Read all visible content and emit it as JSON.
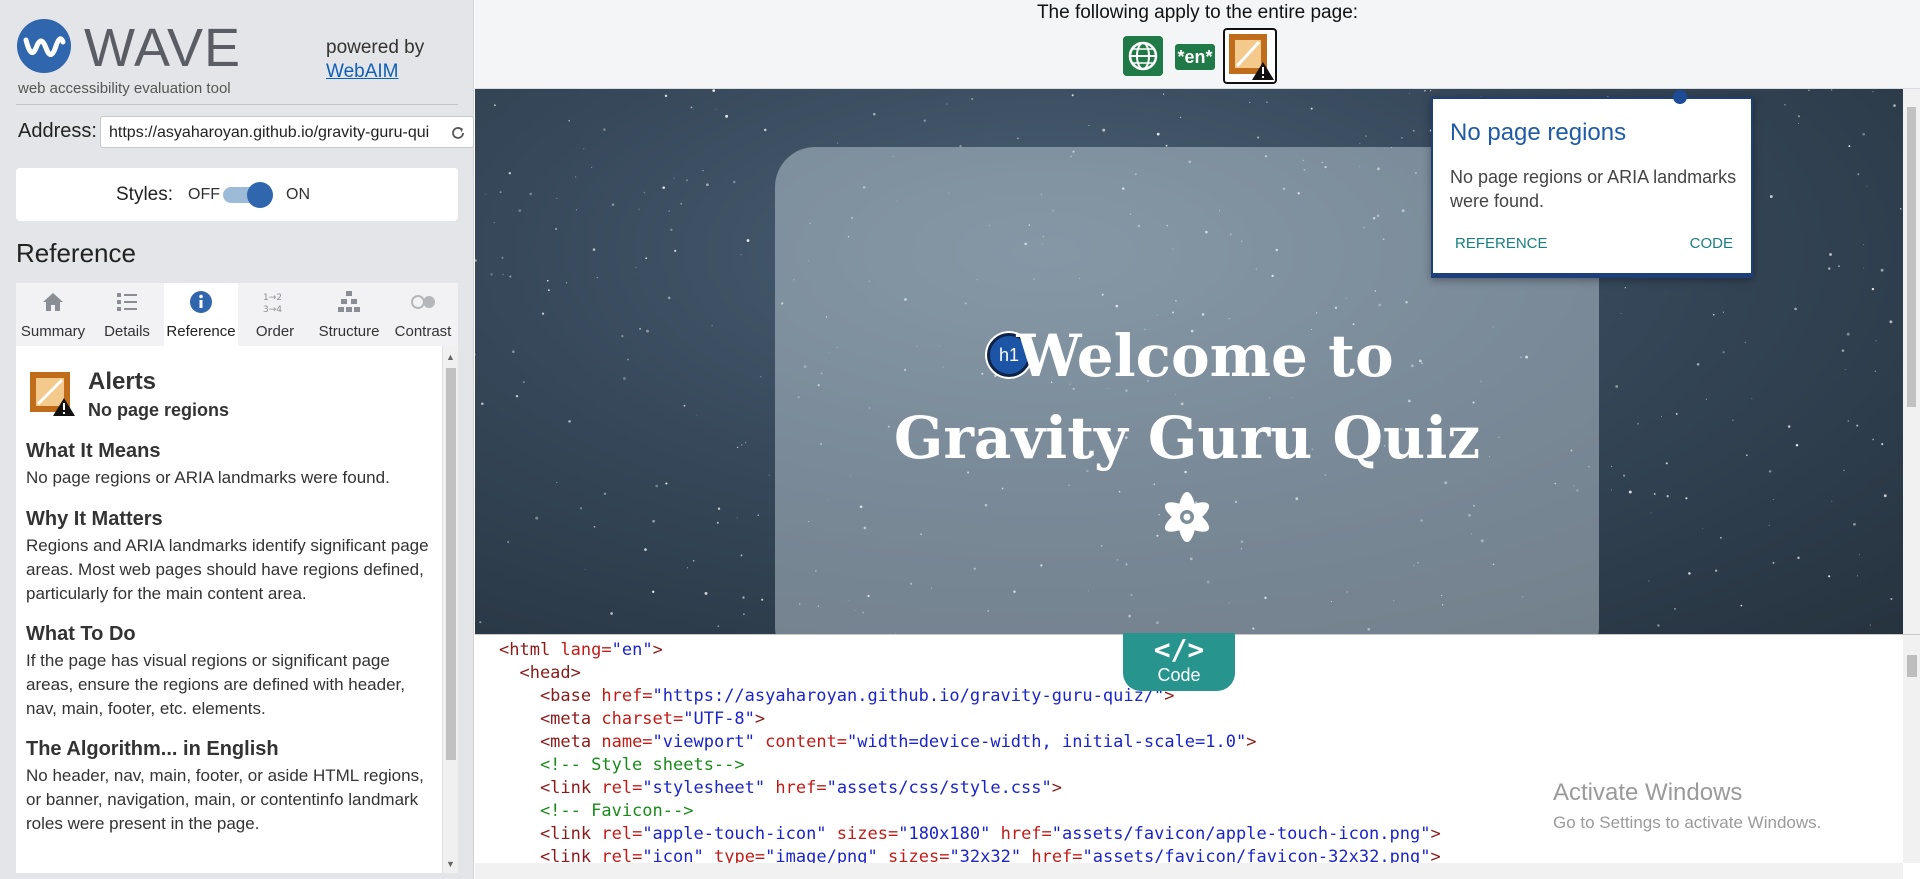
{
  "colors": {
    "accent": "#2f66ad",
    "teal": "#27948e",
    "sidebar_bg": "#e4e5e8",
    "lang_green": "#1f7a47"
  },
  "brand": {
    "name": "WAVE",
    "tagline": "web accessibility evaluation tool",
    "powered_by": "powered by",
    "webaim": "WebAIM"
  },
  "address": {
    "label": "Address:",
    "value": "https://asyaharoyan.github.io/gravity-guru-quiz/"
  },
  "styles": {
    "label": "Styles:",
    "off": "OFF",
    "on": "ON",
    "enabled": true
  },
  "sidebar_heading": "Reference",
  "tabs": [
    {
      "label": "Summary",
      "icon": "home-icon"
    },
    {
      "label": "Details",
      "icon": "list-icon"
    },
    {
      "label": "Reference",
      "icon": "info-icon",
      "active": true
    },
    {
      "label": "Order",
      "icon": "order-icon"
    },
    {
      "label": "Structure",
      "icon": "structure-icon"
    },
    {
      "label": "Contrast",
      "icon": "contrast-icon"
    }
  ],
  "reference": {
    "type": "Alerts",
    "name": "No page regions",
    "sections": [
      {
        "heading": "What It Means",
        "text": "No page regions or ARIA landmarks were found."
      },
      {
        "heading": "Why It Matters",
        "text": "Regions and ARIA landmarks identify significant page areas. Most web pages should have regions defined, particularly for the main content area."
      },
      {
        "heading": "What To Do",
        "text": "If the page has visual regions or significant page areas, ensure the regions are defined with header, nav, main, footer, etc. elements."
      },
      {
        "heading": "The Algorithm... in English",
        "text": "No header, nav, main, footer, or aside HTML regions, or banner, navigation, main, or contentinfo landmark roles were present in the page."
      }
    ]
  },
  "page_level": {
    "text": "The following apply to the entire page:",
    "lang_badge": "*en*"
  },
  "popup": {
    "title": "No page regions",
    "description": "No page regions or ARIA landmarks were found.",
    "reference_link": "REFERENCE",
    "code_link": "CODE"
  },
  "hero": {
    "marker": "h1",
    "line1": "Welcome to",
    "line2": "Gravity Guru Quiz"
  },
  "code_toggle": {
    "glyph": "</>",
    "label": "Code"
  },
  "code_lines": [
    [
      [
        "tg",
        "<html "
      ],
      [
        "at",
        "lang="
      ],
      [
        "vl",
        "\"en\""
      ],
      [
        "tg",
        ">"
      ]
    ],
    [
      [
        "tg",
        "  <head>"
      ]
    ],
    [
      [
        "tg",
        "    <base "
      ],
      [
        "at",
        "href="
      ],
      [
        "vl",
        "\"https://asyaharoyan.github.io/gravity-guru-quiz/\""
      ],
      [
        "tg",
        ">"
      ]
    ],
    [
      [
        "tg",
        "    <meta "
      ],
      [
        "at",
        "charset="
      ],
      [
        "vl",
        "\"UTF-8\""
      ],
      [
        "tg",
        ">"
      ]
    ],
    [
      [
        "tg",
        "    <meta "
      ],
      [
        "at",
        "name="
      ],
      [
        "vl",
        "\"viewport\""
      ],
      [
        "tx",
        " "
      ],
      [
        "at",
        "content="
      ],
      [
        "vl",
        "\"width=device-width, initial-scale=1.0\""
      ],
      [
        "tg",
        ">"
      ]
    ],
    [
      [
        "cm",
        "    <!-- Style sheets-->"
      ]
    ],
    [
      [
        "tg",
        "    <link "
      ],
      [
        "at",
        "rel="
      ],
      [
        "vl",
        "\"stylesheet\""
      ],
      [
        "tx",
        " "
      ],
      [
        "at",
        "href="
      ],
      [
        "vl",
        "\"assets/css/style.css\""
      ],
      [
        "tg",
        ">"
      ]
    ],
    [
      [
        "cm",
        "    <!-- Favicon-->"
      ]
    ],
    [
      [
        "tg",
        "    <link "
      ],
      [
        "at",
        "rel="
      ],
      [
        "vl",
        "\"apple-touch-icon\""
      ],
      [
        "tx",
        " "
      ],
      [
        "at",
        "sizes="
      ],
      [
        "vl",
        "\"180x180\""
      ],
      [
        "tx",
        " "
      ],
      [
        "at",
        "href="
      ],
      [
        "vl",
        "\"assets/favicon/apple-touch-icon.png\""
      ],
      [
        "tg",
        ">"
      ]
    ],
    [
      [
        "tg",
        "    <link "
      ],
      [
        "at",
        "rel="
      ],
      [
        "vl",
        "\"icon\""
      ],
      [
        "tx",
        " "
      ],
      [
        "at",
        "type="
      ],
      [
        "vl",
        "\"image/png\""
      ],
      [
        "tx",
        " "
      ],
      [
        "at",
        "sizes="
      ],
      [
        "vl",
        "\"32x32\""
      ],
      [
        "tx",
        " "
      ],
      [
        "at",
        "href="
      ],
      [
        "vl",
        "\"assets/favicon/favicon-32x32.png\""
      ],
      [
        "tg",
        ">"
      ]
    ]
  ],
  "watermark": {
    "title": "Activate Windows",
    "subtitle": "Go to Settings to activate Windows."
  }
}
